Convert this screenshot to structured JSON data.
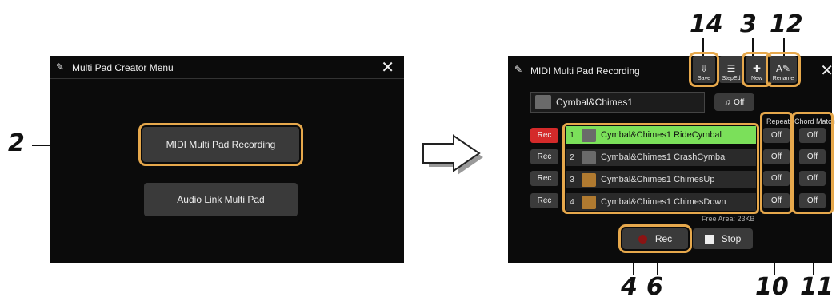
{
  "callouts": {
    "c2": "2",
    "c14": "14",
    "c3": "3",
    "c12": "12",
    "c4": "4",
    "c6": "6",
    "c10": "10",
    "c11": "11"
  },
  "left_screen": {
    "title": "Multi Pad Creator Menu",
    "button1": "MIDI Multi Pad Recording",
    "button2": "Audio Link Multi Pad",
    "close": "✕"
  },
  "right_screen": {
    "title": "MIDI Multi Pad Recording",
    "close": "✕",
    "toolbar": {
      "save": "Save",
      "steped": "StepEd",
      "new": "New",
      "rename": "Rename"
    },
    "bank_name": "Cymbal&Chimes1",
    "metronome": "Off",
    "col_repeat": "Repeat",
    "col_chord": "Chord Match",
    "rec_label": "Rec",
    "pads": [
      {
        "num": "1",
        "name": "Cymbal&Chimes1 RideCymbal",
        "rec": "Rec",
        "repeat": "Off",
        "chord": "Off"
      },
      {
        "num": "2",
        "name": "Cymbal&Chimes1 CrashCymbal",
        "rec": "Rec",
        "repeat": "Off",
        "chord": "Off"
      },
      {
        "num": "3",
        "name": "Cymbal&Chimes1 ChimesUp",
        "rec": "Rec",
        "repeat": "Off",
        "chord": "Off"
      },
      {
        "num": "4",
        "name": "Cymbal&Chimes1 ChimesDown",
        "rec": "Rec",
        "repeat": "Off",
        "chord": "Off"
      }
    ],
    "free_area": "Free Area: 23KB",
    "rec_button": "Rec",
    "stop_button": "Stop"
  },
  "colors": {
    "accent": "#e6a84c",
    "selected": "#7be05a",
    "rec_red": "#d42a2a"
  }
}
